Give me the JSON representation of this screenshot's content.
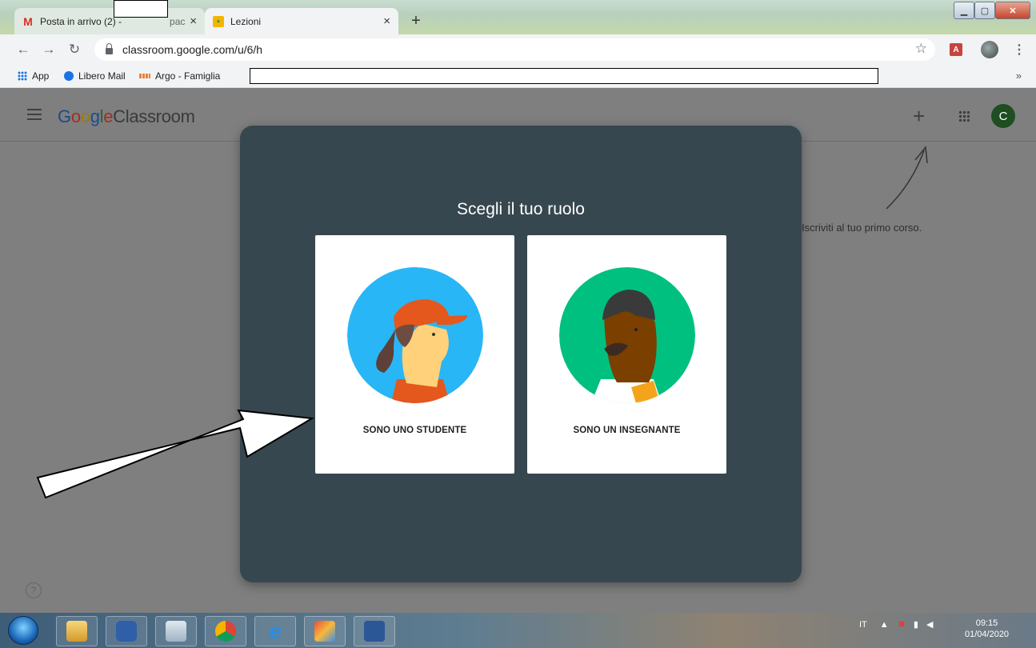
{
  "browser": {
    "tabs": [
      {
        "title": "Posta in arrivo (2) -",
        "title_tail": "pac",
        "icon": "gmail-icon"
      },
      {
        "title": "Lezioni",
        "icon": "classroom-icon"
      }
    ],
    "tab_close": "×",
    "new_tab": "+",
    "url": "classroom.google.com/u/6/h",
    "bookmarks": [
      {
        "label": "App",
        "icon": "apps-grid-icon"
      },
      {
        "label": "Libero Mail",
        "icon": "libero-icon"
      },
      {
        "label": "Argo - Famiglia",
        "icon": "argo-icon"
      }
    ],
    "bookmarks_more": "»"
  },
  "classroom": {
    "brand_google": [
      "G",
      "o",
      "o",
      "g",
      "l",
      "e"
    ],
    "brand_classroom": "Classroom",
    "avatar_letter": "C",
    "add_icon": "+",
    "empty_hint": "Iscriviti al tuo primo corso.",
    "help": "?"
  },
  "role_dialog": {
    "title": "Scegli il tuo ruolo",
    "options": [
      {
        "label": "SONO UNO STUDENTE"
      },
      {
        "label": "SONO UN INSEGNANTE"
      }
    ]
  },
  "taskbar": {
    "tray_lang": "IT",
    "time": "09:15",
    "date": "01/04/2020"
  },
  "colors": {
    "dialog_bg": "#37474f",
    "page_dim": "#7f7f7f",
    "student_circle": "#29b6f6",
    "teacher_circle": "#00c07f"
  }
}
